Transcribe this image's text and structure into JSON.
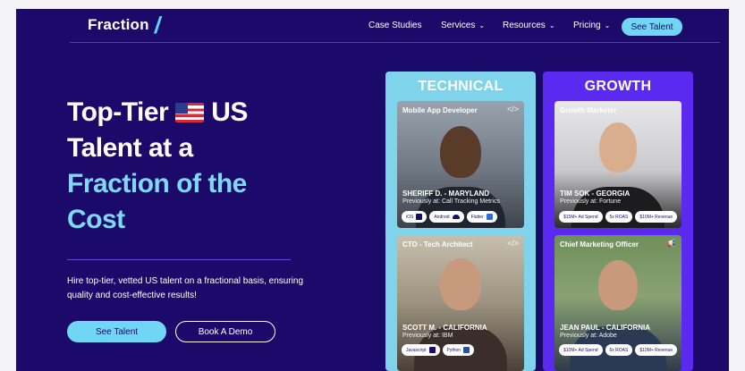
{
  "nav": {
    "logo_text": "Fraction",
    "logo_slash": "/",
    "items": [
      {
        "label": "Case Studies"
      },
      {
        "label": "Services",
        "chevron": "⌄"
      },
      {
        "label": "Resources",
        "chevron": "⌄"
      },
      {
        "label": "Pricing",
        "chevron": "⌄"
      }
    ],
    "cta": "See Talent"
  },
  "hero": {
    "line1_a": "Top-Tier",
    "line1_b": "US",
    "line2": "Talent at a",
    "line3": "Fraction of the",
    "line4": "Cost",
    "subtitle": "Hire top-tier, vetted US talent on a fractional basis, ensuring quality and cost-effective results!",
    "primary_button": "See Talent",
    "secondary_button": "Book A Demo"
  },
  "columns": [
    {
      "title": "TECHNICAL",
      "cards": [
        {
          "role": "Mobile App Developer",
          "icon": "</>",
          "name": "SHERIFF D. - MARYLAND",
          "previously": "Previously at: Call Tracking Metrics",
          "tags": [
            "iOS",
            "Android",
            "Flutter"
          ]
        },
        {
          "role": "CTO - Tech Architect",
          "icon": "</>",
          "name": "SCOTT M. - CALIFORNIA",
          "previously": "Previously at: IBM",
          "tags": [
            "Javascript",
            "Python"
          ]
        }
      ]
    },
    {
      "title": "GROWTH",
      "cards": [
        {
          "role": "Growth Marketer",
          "icon": "",
          "name": "TIM SOK - GEORGIA",
          "previously": "Previously at: Fortune",
          "tags": [
            "$15M+ Ad Spend",
            "5x ROAS",
            "$10M+ Revenue"
          ]
        },
        {
          "role": "Chief Marketing Officer",
          "icon": "📢",
          "name": "JEAN PAUL - CALIFORNIA",
          "previously": "Previously at: Adobe",
          "tags": [
            "$10M+ Ad Spend",
            "6x ROAS",
            "$10M+ Revenue"
          ]
        }
      ]
    }
  ],
  "colors": {
    "background": "#1c0a6b",
    "accent": "#6fd6f3",
    "technical_column": "#7fd3ea",
    "growth_column": "#5a2af0"
  }
}
